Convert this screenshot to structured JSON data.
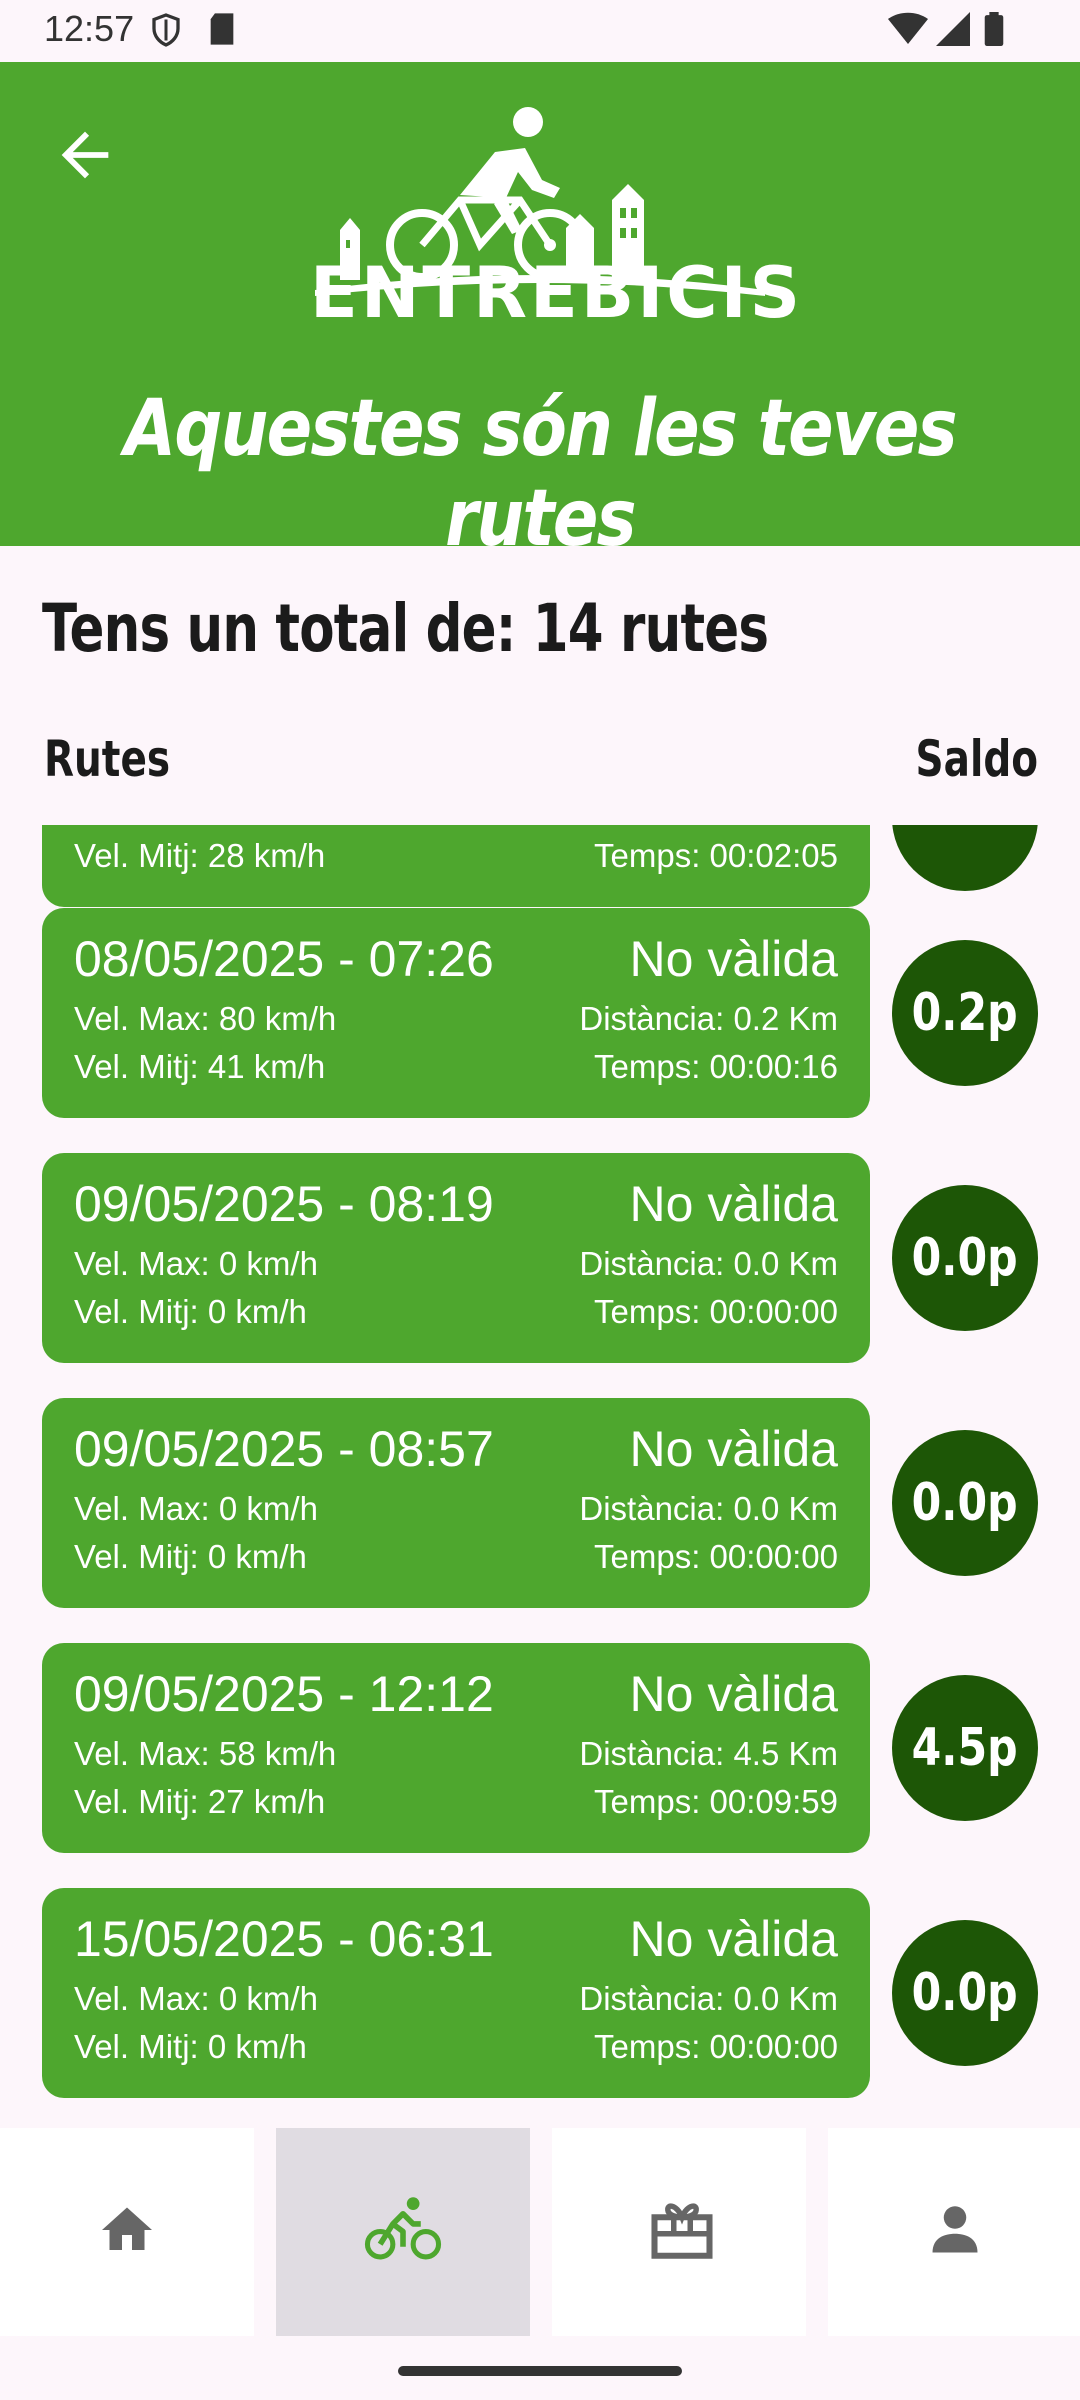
{
  "status_bar": {
    "time": "12:57"
  },
  "header": {
    "back_label": "back",
    "logo_text": "ENTREBICIS",
    "title": "Aquestes són les teves rutes"
  },
  "summary": {
    "total_text": "Tens un total de: 14 rutes"
  },
  "columns": {
    "left": "Rutes",
    "right": "Saldo"
  },
  "partial_route": {
    "vel_mitj": "Vel. Mitj: 28 km/h",
    "temps": "Temps: 00:02:05"
  },
  "routes": [
    {
      "date": "08/05/2025 - 07:26",
      "status": "No vàlida",
      "vel_max": "Vel. Max: 80 km/h",
      "vel_mitj": "Vel. Mitj: 41 km/h",
      "distancia": "Distància: 0.2 Km",
      "temps": "Temps: 00:00:16",
      "points": "0.2p"
    },
    {
      "date": "09/05/2025 - 08:19",
      "status": "No vàlida",
      "vel_max": "Vel. Max: 0 km/h",
      "vel_mitj": "Vel. Mitj: 0 km/h",
      "distancia": "Distància: 0.0 Km",
      "temps": "Temps: 00:00:00",
      "points": "0.0p"
    },
    {
      "date": "09/05/2025 - 08:57",
      "status": "No vàlida",
      "vel_max": "Vel. Max: 0 km/h",
      "vel_mitj": "Vel. Mitj: 0 km/h",
      "distancia": "Distància: 0.0 Km",
      "temps": "Temps: 00:00:00",
      "points": "0.0p"
    },
    {
      "date": "09/05/2025 - 12:12",
      "status": "No vàlida",
      "vel_max": "Vel. Max: 58 km/h",
      "vel_mitj": "Vel. Mitj: 27 km/h",
      "distancia": "Distància: 4.5 Km",
      "temps": "Temps: 00:09:59",
      "points": "4.5p"
    },
    {
      "date": "15/05/2025 - 06:31",
      "status": "No vàlida",
      "vel_max": "Vel. Max: 0 km/h",
      "vel_mitj": "Vel. Mitj: 0 km/h",
      "distancia": "Distància: 0.0 Km",
      "temps": "Temps: 00:00:00",
      "points": "0.0p"
    }
  ],
  "nav": [
    {
      "icon": "home-icon",
      "active": false
    },
    {
      "icon": "bike-icon",
      "active": true
    },
    {
      "icon": "gift-icon",
      "active": false
    },
    {
      "icon": "person-icon",
      "active": false
    }
  ],
  "colors": {
    "green": "#4ea72e",
    "dark_green": "#1d5606",
    "background": "#fdf6fb"
  }
}
